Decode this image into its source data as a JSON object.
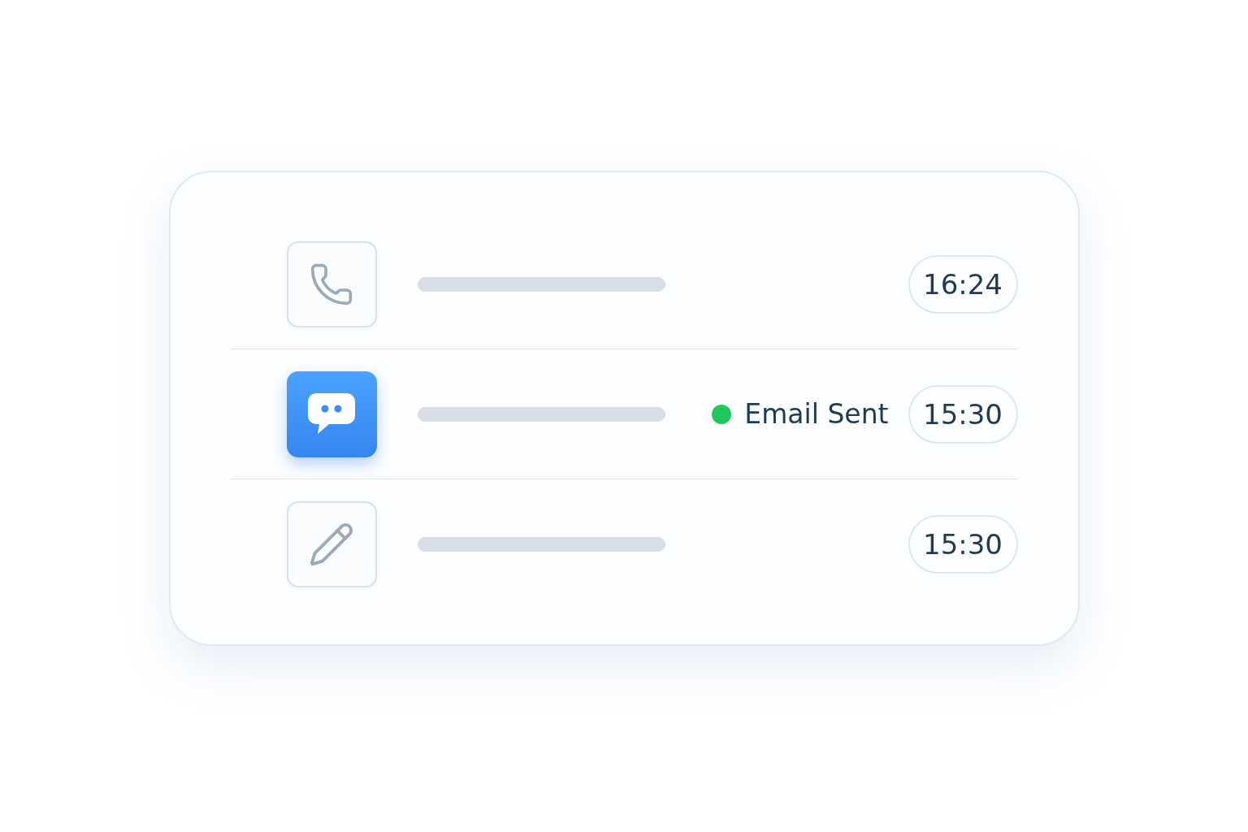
{
  "activity": [
    {
      "kind": "call",
      "selected": false,
      "time": "16:24"
    },
    {
      "kind": "message",
      "selected": true,
      "status": {
        "label": "Email Sent",
        "color": "#1ec85a"
      },
      "time": "15:30"
    },
    {
      "kind": "note",
      "selected": false,
      "time": "15:30"
    }
  ]
}
